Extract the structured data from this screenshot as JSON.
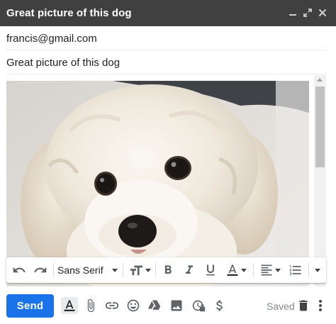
{
  "window": {
    "title": "Great picture of this dog",
    "controls": [
      "minimize-icon",
      "expand-icon",
      "close-icon"
    ]
  },
  "compose": {
    "recipient": "francis@gmail.com",
    "subject": "Great picture of this dog",
    "body_image": "dog-photo"
  },
  "format_toolbar": {
    "font": "Sans Serif",
    "tools": [
      "undo-icon",
      "redo-icon",
      "font-select",
      "text-size-icon",
      "bold-icon",
      "italic-icon",
      "underline-icon",
      "text-color-icon",
      "align-icon",
      "numbered-list-icon",
      "more-formatting-icon"
    ]
  },
  "bottom_bar": {
    "send_label": "Send",
    "saved_label": "Saved",
    "tools": [
      "formatting-options-icon",
      "attach-icon",
      "link-icon",
      "emoji-icon",
      "drive-icon",
      "photo-icon",
      "confidential-icon",
      "money-icon",
      "discard-icon",
      "more-options-icon"
    ]
  },
  "colors": {
    "titlebar": "#404040",
    "send": "#1a73e8",
    "icon": "#5f6368"
  }
}
